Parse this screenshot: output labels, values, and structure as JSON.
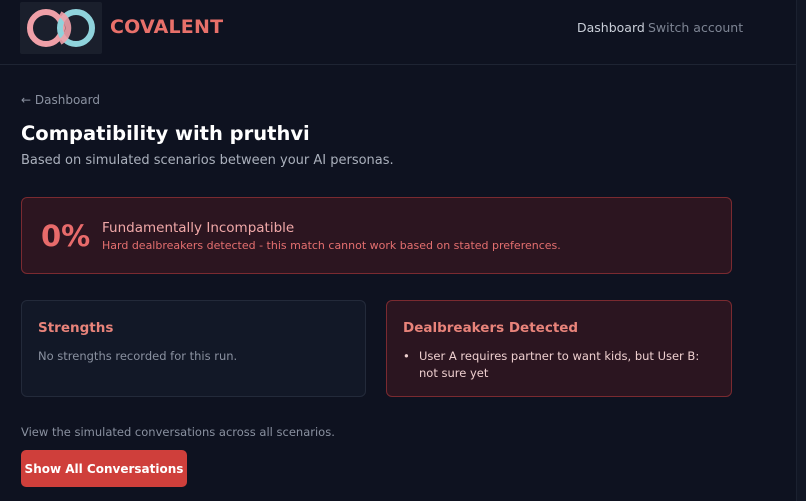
{
  "brand": {
    "name": "COVALENT",
    "logo_icon": "interlocking-rings-icon",
    "logo_colors": [
      "#f0a0a8",
      "#8fd3dc"
    ]
  },
  "nav": {
    "dashboard": "Dashboard",
    "switch_account": "Switch account"
  },
  "back_link": "← Dashboard",
  "page": {
    "title": "Compatibility with pruthvi",
    "subtitle": "Based on simulated scenarios between your AI personas."
  },
  "score": {
    "value": "0%",
    "label": "Fundamentally Incompatible",
    "description": "Hard dealbreakers detected - this match cannot work based on stated preferences."
  },
  "strengths": {
    "title": "Strengths",
    "empty_text": "No strengths recorded for this run."
  },
  "dealbreakers": {
    "title": "Dealbreakers Detected",
    "items": [
      "User A requires partner to want kids, but User B: not sure yet"
    ]
  },
  "footer": {
    "text": "View the simulated conversations across all scenarios.",
    "button": "Show All Conversations"
  },
  "colors": {
    "accent": "#cf3f3b",
    "danger_text": "#e86b6b",
    "background": "#0e1220"
  }
}
